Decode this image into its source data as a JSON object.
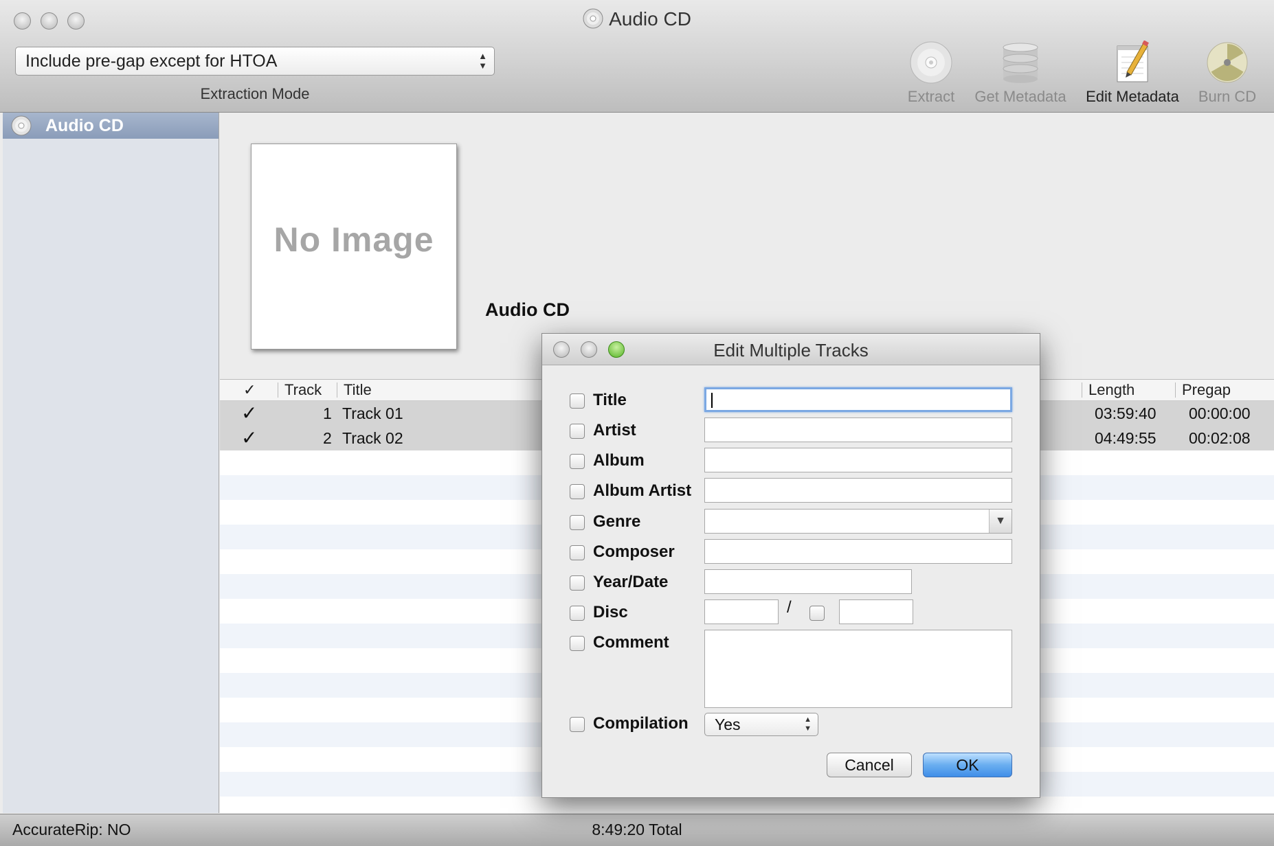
{
  "window": {
    "title": "Audio CD"
  },
  "toolbar": {
    "extraction_mode": {
      "value": "Include pre-gap except for HTOA",
      "label": "Extraction Mode"
    },
    "tools": [
      {
        "label": "Extract",
        "icon": "cd-icon",
        "enabled": false
      },
      {
        "label": "Get Metadata",
        "icon": "database-icon",
        "enabled": false
      },
      {
        "label": "Edit Metadata",
        "icon": "notepad-pencil-icon",
        "enabled": true
      },
      {
        "label": "Burn CD",
        "icon": "radiation-icon",
        "enabled": false
      }
    ]
  },
  "sidebar": {
    "items": [
      {
        "label": "Audio CD",
        "icon": "cd-icon",
        "selected": true
      }
    ]
  },
  "main": {
    "cover": {
      "placeholder": "No Image"
    },
    "album_title": "Audio CD",
    "table": {
      "headers": {
        "check": "✓",
        "track": "Track",
        "title": "Title",
        "length": "Length",
        "pregap": "Pregap"
      },
      "rows": [
        {
          "checked": "✓",
          "track": "1",
          "title": "Track 01",
          "length": "03:59:40",
          "pregap": "00:00:00"
        },
        {
          "checked": "✓",
          "track": "2",
          "title": "Track 02",
          "length": "04:49:55",
          "pregap": "00:02:08"
        }
      ]
    }
  },
  "status": {
    "accuraterip": "AccurateRip:  NO",
    "total": "8:49:20 Total"
  },
  "dialog": {
    "title": "Edit Multiple Tracks",
    "fields": {
      "title": "Title",
      "artist": "Artist",
      "album": "Album",
      "album_artist": "Album Artist",
      "genre": "Genre",
      "composer": "Composer",
      "year": "Year/Date",
      "disc": "Disc",
      "disc_separator": "/",
      "comment": "Comment",
      "compilation": "Compilation"
    },
    "compilation_value": "Yes",
    "buttons": {
      "cancel": "Cancel",
      "ok": "OK"
    }
  }
}
